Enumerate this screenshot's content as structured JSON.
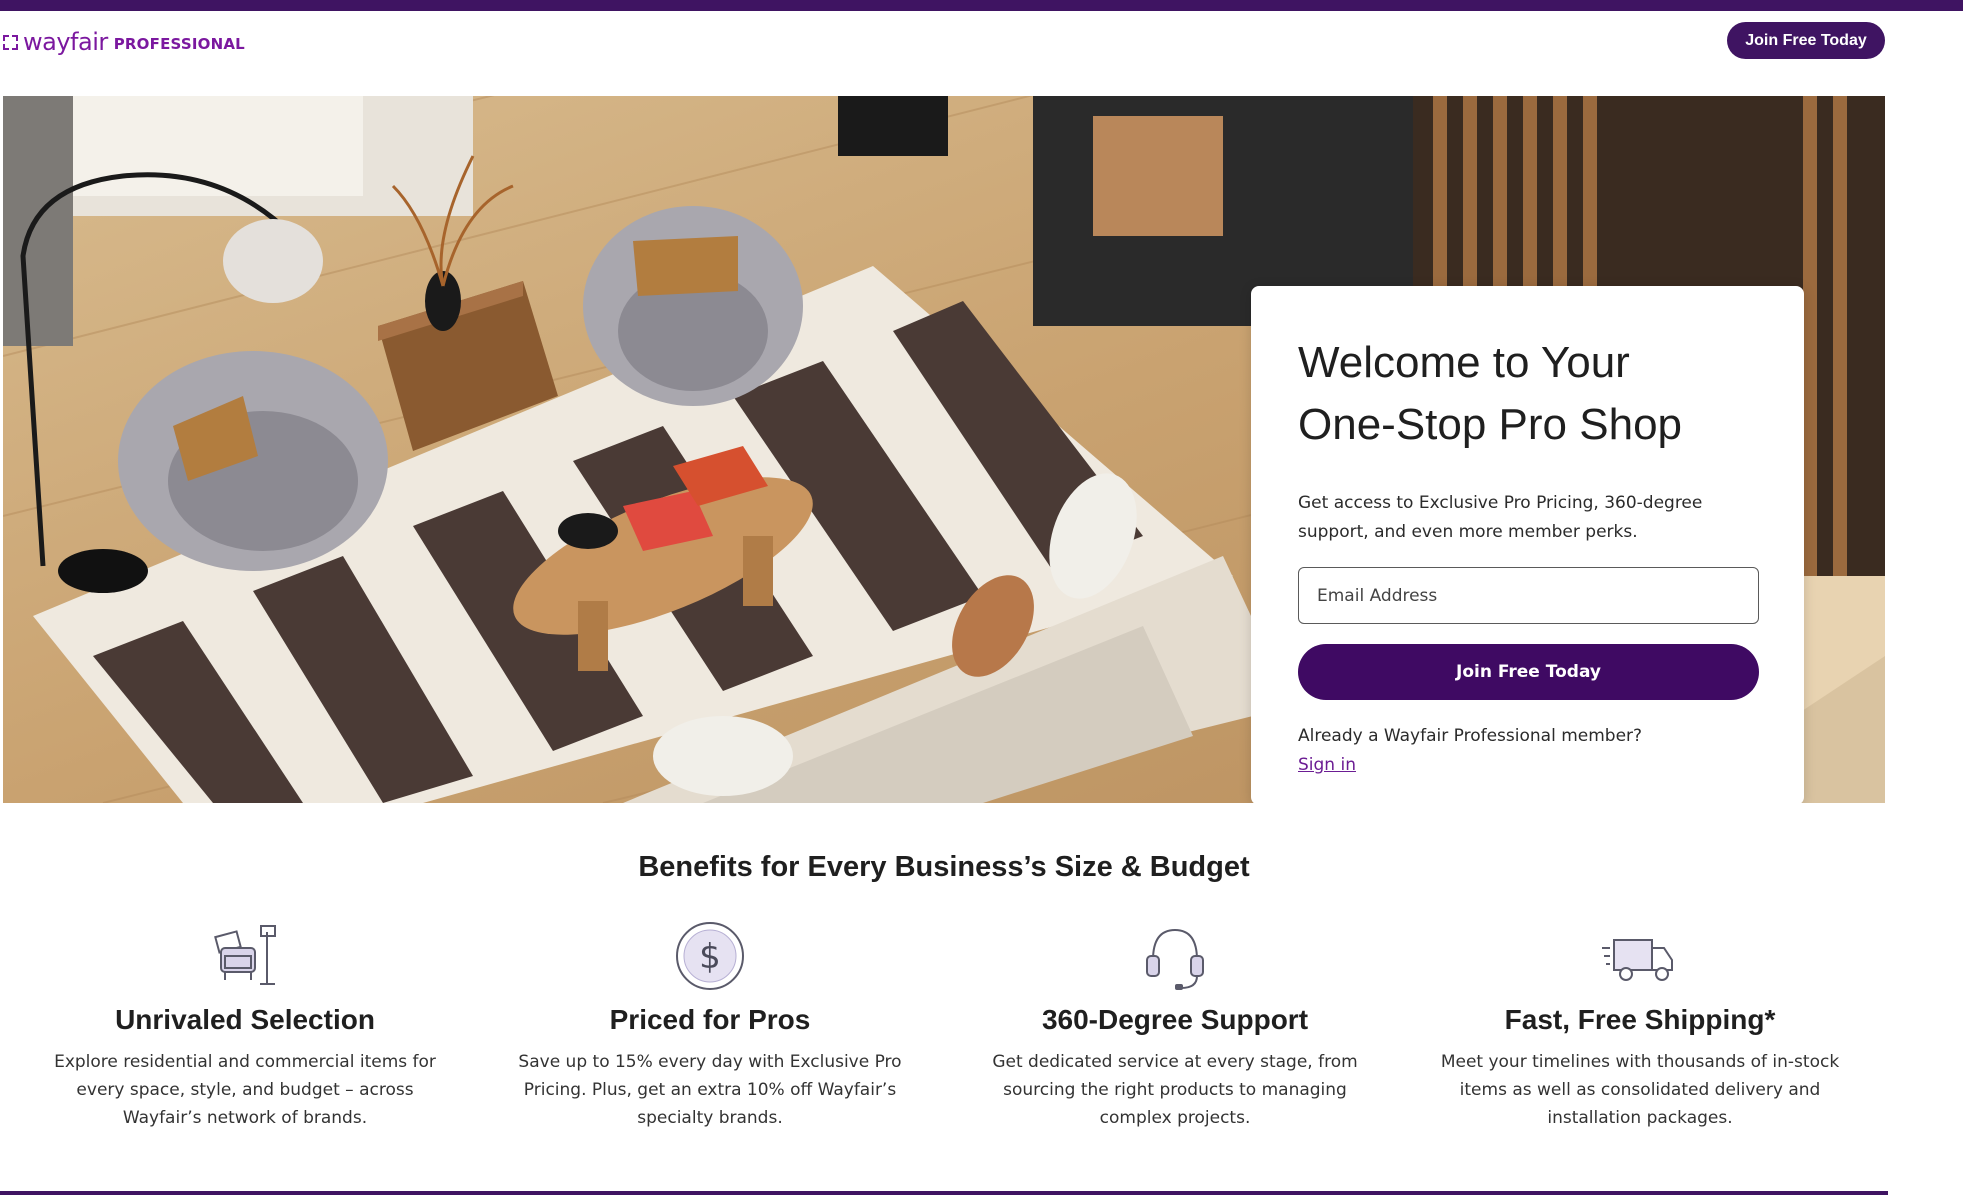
{
  "header": {
    "logo_word": "wayfair",
    "logo_suffix": "PROFESSIONAL",
    "cta_label": "Join Free Today"
  },
  "hero": {
    "title_line1": "Welcome to Your",
    "title_line2": "One-Stop Pro Shop",
    "subtitle": "Get access to Exclusive Pro Pricing, 360-degree support, and even more member perks.",
    "email_placeholder": "Email Address",
    "join_label": "Join Free Today",
    "member_question": "Already a Wayfair Professional member?",
    "sign_in_label": "Sign in"
  },
  "benefits": {
    "title": "Benefits for Every Business’s Size & Budget",
    "items": [
      {
        "icon": "furniture-icon",
        "title": "Unrivaled Selection",
        "text": "Explore residential and commercial items for every space, style, and budget – across Wayfair’s network of brands."
      },
      {
        "icon": "dollar-icon",
        "title": "Priced for Pros",
        "text": "Save up to 15% every day with Exclusive Pro Pricing. Plus, get an extra 10% off Wayfair’s specialty brands."
      },
      {
        "icon": "headset-icon",
        "title": "360-Degree Support",
        "text": "Get dedicated service at every stage, from sourcing the right products to managing complex projects."
      },
      {
        "icon": "delivery-truck-icon",
        "title": "Fast, Free Shipping*",
        "text": "Meet your timelines with thousands of in-stock items as well as consolidated delivery and installation packages."
      }
    ]
  },
  "colors": {
    "brand_purple": "#3f1462",
    "logo_purple": "#7b189f",
    "button_purple": "#3f0a63"
  }
}
